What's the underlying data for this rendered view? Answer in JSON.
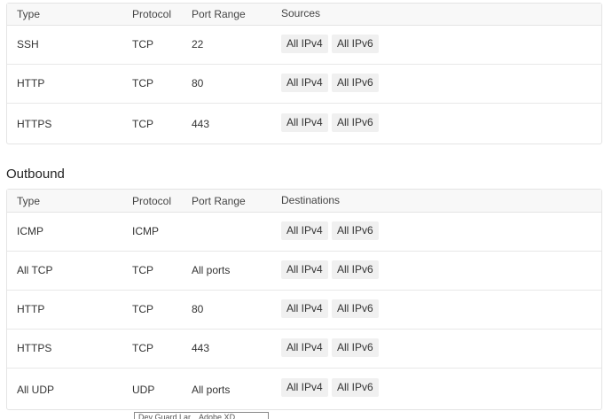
{
  "inbound": {
    "columns": {
      "type": "Type",
      "protocol": "Protocol",
      "port_range": "Port Range",
      "sources": "Sources"
    },
    "rows": [
      {
        "type": "SSH",
        "protocol": "TCP",
        "port_range": "22",
        "tags": [
          "All IPv4",
          "All IPv6"
        ]
      },
      {
        "type": "HTTP",
        "protocol": "TCP",
        "port_range": "80",
        "tags": [
          "All IPv4",
          "All IPv6"
        ]
      },
      {
        "type": "HTTPS",
        "protocol": "TCP",
        "port_range": "443",
        "tags": [
          "All IPv4",
          "All IPv6"
        ]
      }
    ]
  },
  "outbound": {
    "title": "Outbound",
    "columns": {
      "type": "Type",
      "protocol": "Protocol",
      "port_range": "Port Range",
      "destinations": "Destinations"
    },
    "rows": [
      {
        "type": "ICMP",
        "protocol": "ICMP",
        "port_range": "",
        "tags": [
          "All IPv4",
          "All IPv6"
        ]
      },
      {
        "type": "All TCP",
        "protocol": "TCP",
        "port_range": "All ports",
        "tags": [
          "All IPv4",
          "All IPv6"
        ]
      },
      {
        "type": "HTTP",
        "protocol": "TCP",
        "port_range": "80",
        "tags": [
          "All IPv4",
          "All IPv6"
        ]
      },
      {
        "type": "HTTPS",
        "protocol": "TCP",
        "port_range": "443",
        "tags": [
          "All IPv4",
          "All IPv6"
        ]
      },
      {
        "type": "All UDP",
        "protocol": "UDP",
        "port_range": "All ports",
        "tags": [
          "All IPv4",
          "All IPv6"
        ]
      }
    ]
  },
  "tooltip": {
    "text": "Dev Guard Lar...           Adobe XD"
  }
}
